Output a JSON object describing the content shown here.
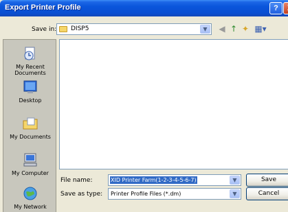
{
  "window": {
    "title": "Export Printer Profile",
    "help_label": "?",
    "close_label": "X"
  },
  "save_in": {
    "label": "Save in:",
    "value": "DISP5"
  },
  "places": [
    {
      "label": "My Recent Documents",
      "icon": "recent-documents-icon"
    },
    {
      "label": "Desktop",
      "icon": "desktop-icon"
    },
    {
      "label": "My Documents",
      "icon": "my-documents-icon"
    },
    {
      "label": "My Computer",
      "icon": "my-computer-icon"
    },
    {
      "label": "My Network",
      "icon": "my-network-icon"
    }
  ],
  "file_name": {
    "label": "File name:",
    "value": "XID Printer Farm(1-2-3-4-5-6-7)"
  },
  "save_as_type": {
    "label": "Save as type:",
    "value": "Printer Profile Files (*.dm)"
  },
  "buttons": {
    "save": "Save",
    "cancel": "Cancel"
  },
  "colors": {
    "title_bar": "#0a55db",
    "selection": "#316ac5",
    "dialog_bg": "#ece9d8"
  }
}
